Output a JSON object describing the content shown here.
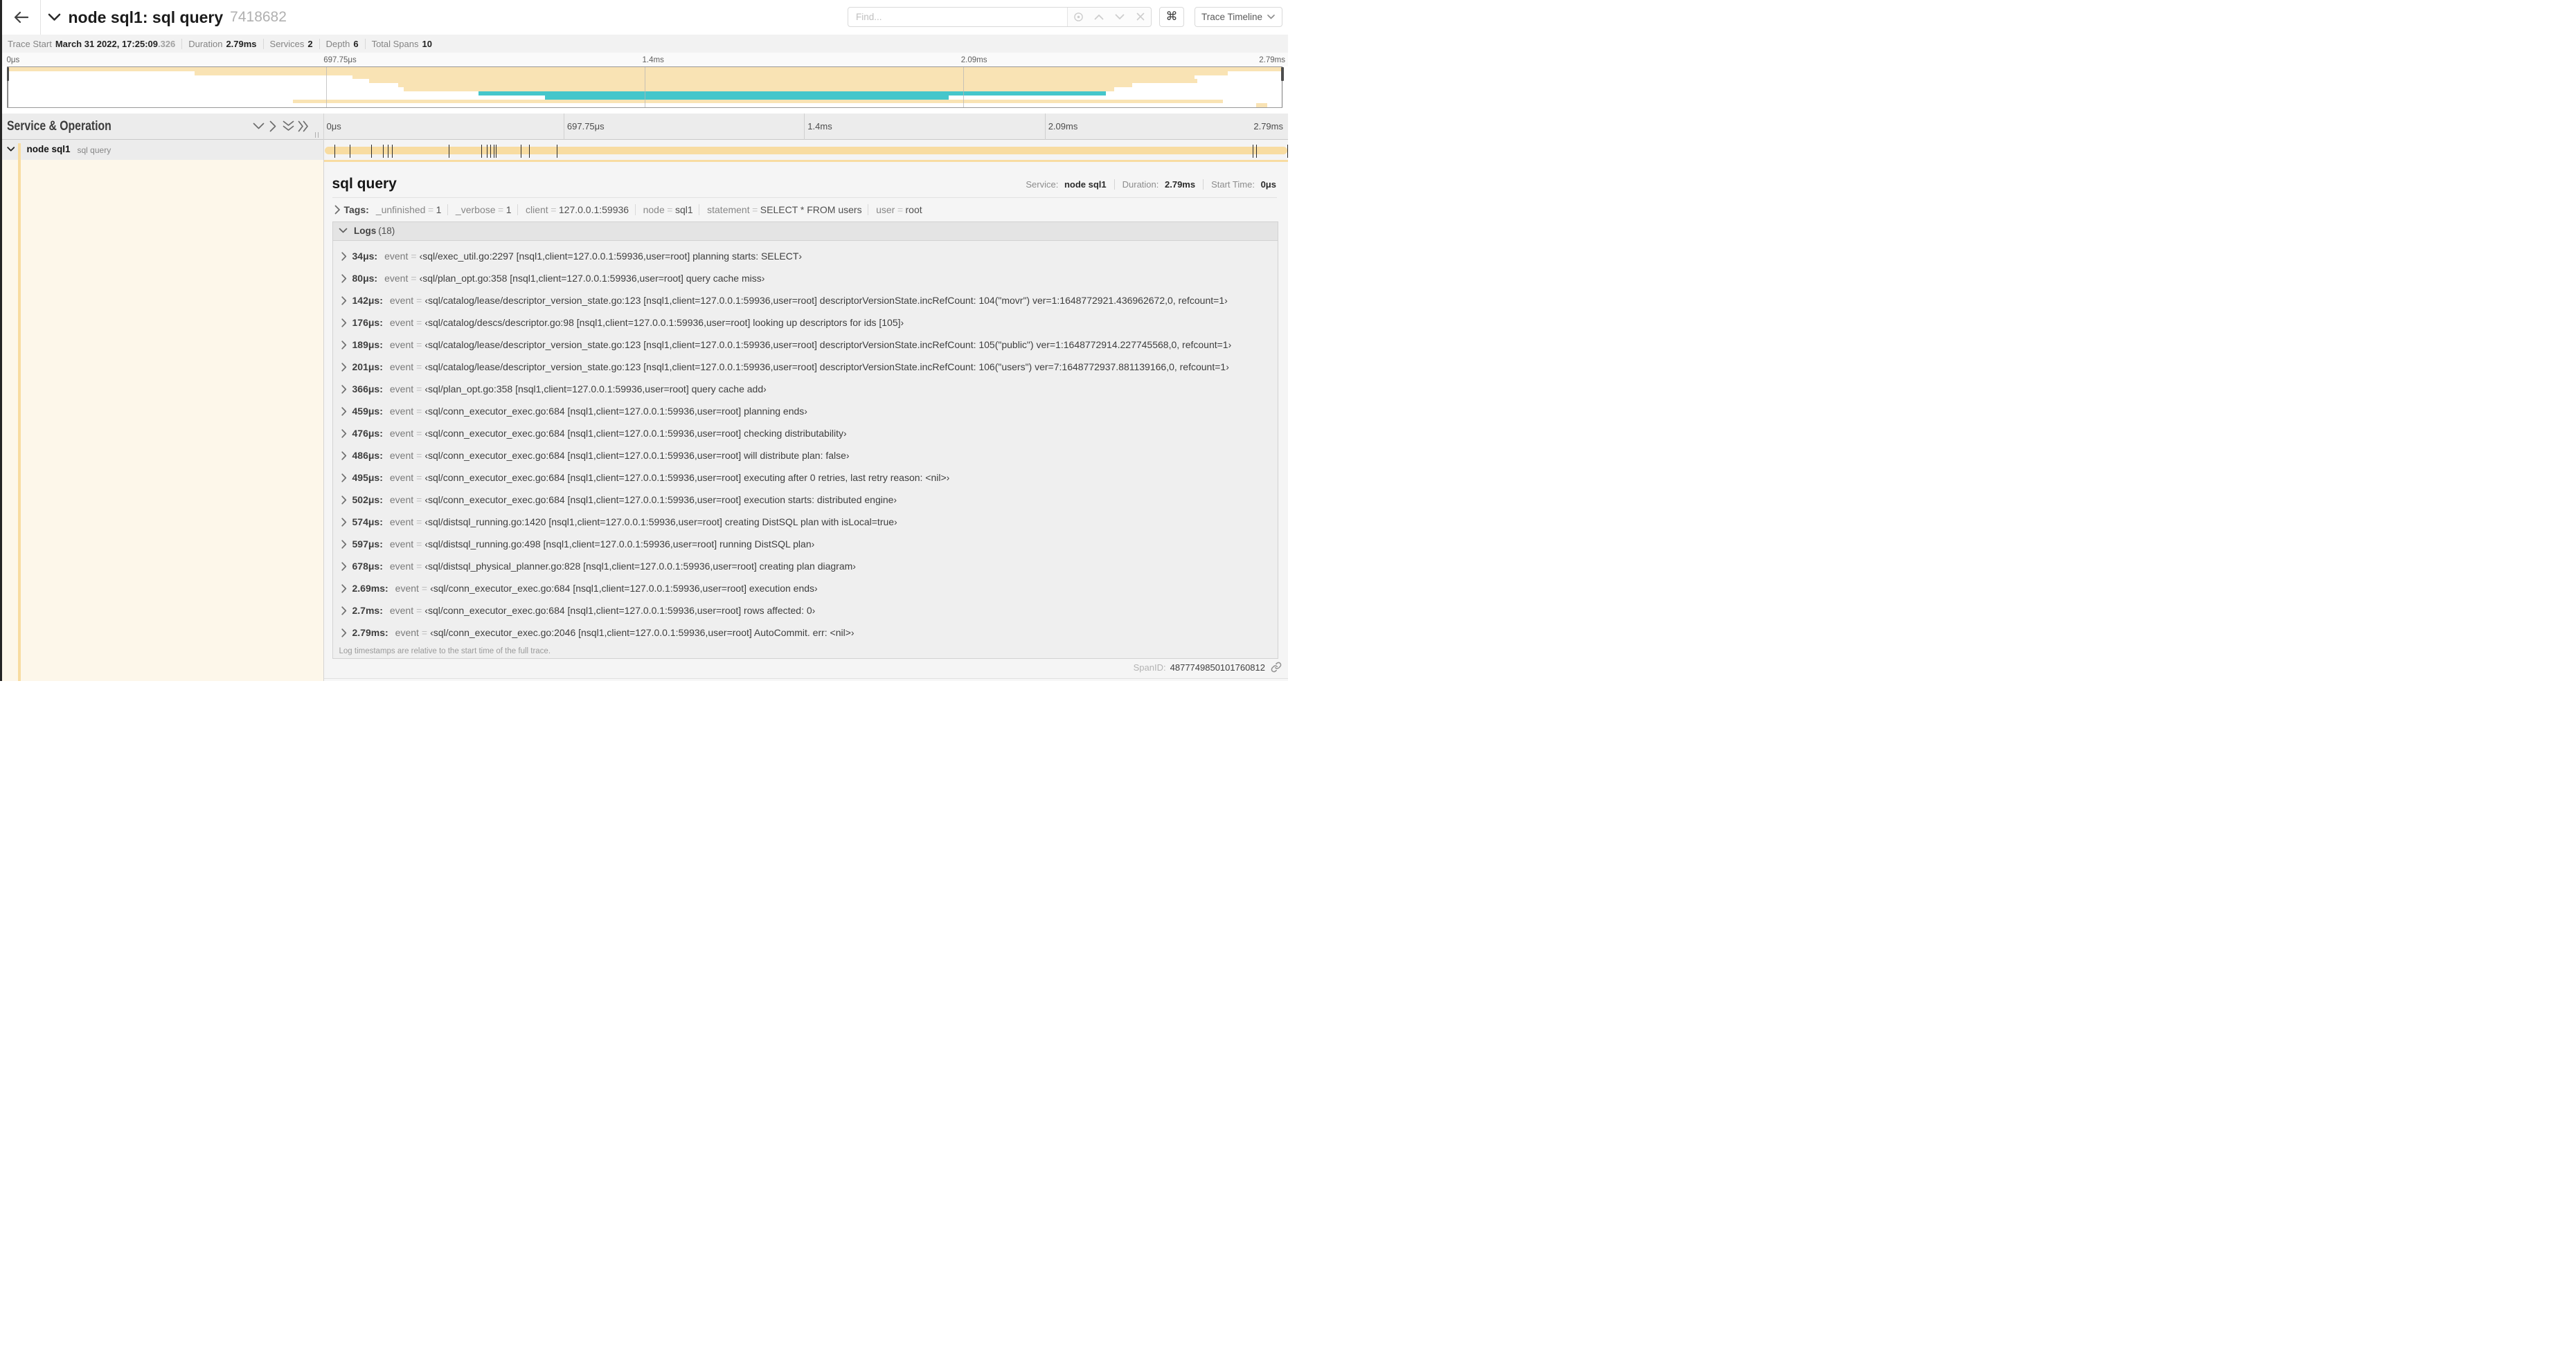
{
  "header": {
    "title": "node sql1: sql query",
    "trace_id": "7418682",
    "find_placeholder": "Find...",
    "command_symbol": "⌘",
    "view_dropdown": "Trace Timeline"
  },
  "summary": {
    "items": [
      {
        "label": "Trace Start",
        "value": "March 31 2022, 17:25:09",
        "suffix": ".326"
      },
      {
        "label": "Duration",
        "value": "2.79ms",
        "suffix": ""
      },
      {
        "label": "Services",
        "value": "2",
        "suffix": ""
      },
      {
        "label": "Depth",
        "value": "6",
        "suffix": ""
      },
      {
        "label": "Total Spans",
        "value": "10",
        "suffix": ""
      }
    ]
  },
  "colors": {
    "tan": "#F8DCA1",
    "teal": "#17B8BE",
    "tan_minimap": "#f9e3b4",
    "teal_minimap": "#45c6cb"
  },
  "minimap": {
    "ticks": [
      {
        "label": "0μs",
        "pos": 0,
        "align": "left"
      },
      {
        "label": "697.75μs",
        "pos": 25,
        "align": "left"
      },
      {
        "label": "1.4ms",
        "pos": 50,
        "align": "left"
      },
      {
        "label": "2.09ms",
        "pos": 75,
        "align": "left"
      },
      {
        "label": "2.79ms",
        "pos": 100,
        "align": "right"
      }
    ],
    "spans": [
      {
        "row": 0,
        "start": 0.0,
        "end": 100.0,
        "color": "#f9e3b4"
      },
      {
        "row": 1,
        "start": 14.7,
        "end": 95.8,
        "color": "#f9e3b4"
      },
      {
        "row": 2,
        "start": 27.1,
        "end": 93.2,
        "color": "#f9e3b4"
      },
      {
        "row": 3,
        "start": 28.4,
        "end": 93.4,
        "color": "#f9e3b4"
      },
      {
        "row": 4,
        "start": 30.7,
        "end": 88.3,
        "color": "#f9e3b4"
      },
      {
        "row": 5,
        "start": 31.1,
        "end": 86.9,
        "color": "#f9e3b4"
      },
      {
        "row": 6,
        "start": 37.0,
        "end": 86.2,
        "color": "#45c6cb"
      },
      {
        "row": 7,
        "start": 42.2,
        "end": 73.9,
        "color": "#45c6cb"
      },
      {
        "row": 8,
        "start": 22.4,
        "end": 95.4,
        "color": "#f9e3b4"
      },
      {
        "row": 9,
        "start": 98.0,
        "end": 98.9,
        "color": "#f9e3b4"
      }
    ]
  },
  "timeline": {
    "column_title": "Service & Operation",
    "ticks": [
      {
        "label": "0μs",
        "pos": 0,
        "align": "left"
      },
      {
        "label": "697.75μs",
        "pos": 25,
        "align": "left"
      },
      {
        "label": "1.4ms",
        "pos": 50,
        "align": "left"
      },
      {
        "label": "2.09ms",
        "pos": 75,
        "align": "left"
      },
      {
        "label": "2.79ms",
        "pos": 100,
        "align": "right"
      }
    ]
  },
  "span_row": {
    "service": "node sql1",
    "operation": "sql query",
    "bar_color": "#F8DCA1",
    "tick_positions": [
      1.22,
      2.87,
      5.09,
      6.31,
      6.77,
      7.2,
      13.12,
      16.45,
      17.06,
      17.42,
      17.74,
      17.99,
      20.57,
      21.4,
      24.3,
      96.42,
      96.77,
      100
    ]
  },
  "detail": {
    "title": "sql query",
    "meta": [
      {
        "label": "Service:",
        "value": "node sql1"
      },
      {
        "label": "Duration:",
        "value": "2.79ms"
      },
      {
        "label": "Start Time:",
        "value": "0μs"
      }
    ],
    "tags_label": "Tags:",
    "tags": [
      {
        "key": "_unfinished",
        "value": "1"
      },
      {
        "key": "_verbose",
        "value": "1"
      },
      {
        "key": "client",
        "value": "127.0.0.1:59936"
      },
      {
        "key": "node",
        "value": "sql1"
      },
      {
        "key": "statement",
        "value": "SELECT * FROM users"
      },
      {
        "key": "user",
        "value": "root"
      }
    ],
    "logs_label": "Logs",
    "logs_count": "(18)",
    "logs": [
      {
        "ts": "34μs:",
        "field": "event",
        "value": "‹sql/exec_util.go:2297 [nsql1,client=127.0.0.1:59936,user=root] planning starts: SELECT›"
      },
      {
        "ts": "80μs:",
        "field": "event",
        "value": "‹sql/plan_opt.go:358 [nsql1,client=127.0.0.1:59936,user=root] query cache miss›"
      },
      {
        "ts": "142μs:",
        "field": "event",
        "value": "‹sql/catalog/lease/descriptor_version_state.go:123 [nsql1,client=127.0.0.1:59936,user=root] descriptorVersionState.incRefCount: 104(\"movr\") ver=1:1648772921.436962672,0, refcount=1›"
      },
      {
        "ts": "176μs:",
        "field": "event",
        "value": "‹sql/catalog/descs/descriptor.go:98 [nsql1,client=127.0.0.1:59936,user=root] looking up descriptors for ids [105]›"
      },
      {
        "ts": "189μs:",
        "field": "event",
        "value": "‹sql/catalog/lease/descriptor_version_state.go:123 [nsql1,client=127.0.0.1:59936,user=root] descriptorVersionState.incRefCount: 105(\"public\") ver=1:1648772914.227745568,0, refcount=1›"
      },
      {
        "ts": "201μs:",
        "field": "event",
        "value": "‹sql/catalog/lease/descriptor_version_state.go:123 [nsql1,client=127.0.0.1:59936,user=root] descriptorVersionState.incRefCount: 106(\"users\") ver=7:1648772937.881139166,0, refcount=1›"
      },
      {
        "ts": "366μs:",
        "field": "event",
        "value": "‹sql/plan_opt.go:358 [nsql1,client=127.0.0.1:59936,user=root] query cache add›"
      },
      {
        "ts": "459μs:",
        "field": "event",
        "value": "‹sql/conn_executor_exec.go:684 [nsql1,client=127.0.0.1:59936,user=root] planning ends›"
      },
      {
        "ts": "476μs:",
        "field": "event",
        "value": "‹sql/conn_executor_exec.go:684 [nsql1,client=127.0.0.1:59936,user=root] checking distributability›"
      },
      {
        "ts": "486μs:",
        "field": "event",
        "value": "‹sql/conn_executor_exec.go:684 [nsql1,client=127.0.0.1:59936,user=root] will distribute plan: false›"
      },
      {
        "ts": "495μs:",
        "field": "event",
        "value": "‹sql/conn_executor_exec.go:684 [nsql1,client=127.0.0.1:59936,user=root] executing after 0 retries, last retry reason: <nil>›"
      },
      {
        "ts": "502μs:",
        "field": "event",
        "value": "‹sql/conn_executor_exec.go:684 [nsql1,client=127.0.0.1:59936,user=root] execution starts: distributed engine›"
      },
      {
        "ts": "574μs:",
        "field": "event",
        "value": "‹sql/distsql_running.go:1420 [nsql1,client=127.0.0.1:59936,user=root] creating DistSQL plan with isLocal=true›"
      },
      {
        "ts": "597μs:",
        "field": "event",
        "value": "‹sql/distsql_running.go:498 [nsql1,client=127.0.0.1:59936,user=root] running DistSQL plan›"
      },
      {
        "ts": "678μs:",
        "field": "event",
        "value": "‹sql/distsql_physical_planner.go:828 [nsql1,client=127.0.0.1:59936,user=root] creating plan diagram›"
      },
      {
        "ts": "2.69ms:",
        "field": "event",
        "value": "‹sql/conn_executor_exec.go:684 [nsql1,client=127.0.0.1:59936,user=root] execution ends›"
      },
      {
        "ts": "2.7ms:",
        "field": "event",
        "value": "‹sql/conn_executor_exec.go:684 [nsql1,client=127.0.0.1:59936,user=root] rows affected: 0›"
      },
      {
        "ts": "2.79ms:",
        "field": "event",
        "value": "‹sql/conn_executor_exec.go:2046 [nsql1,client=127.0.0.1:59936,user=root] AutoCommit. err: <nil>›"
      }
    ],
    "logs_note": "Log timestamps are relative to the start time of the full trace.",
    "span_id_label": "SpanID:",
    "span_id": "4877749850101760812"
  }
}
